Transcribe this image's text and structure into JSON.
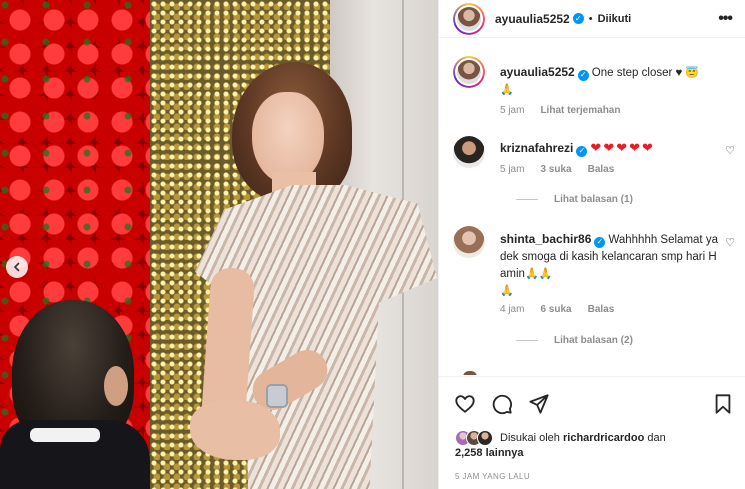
{
  "post": {
    "username": "ayuaulia5252",
    "follow_status": "Diikuti",
    "more_icon": "more-horizontal-icon",
    "caption": {
      "username": "ayuaulia5252",
      "text": "One step closer ♥",
      "emoji": "😇",
      "emoji2": "🙏",
      "time": "5 jam",
      "translate": "Lihat terjemahan"
    },
    "comments": [
      {
        "username": "kriznafahrezi",
        "text": "❤❤❤❤❤",
        "time": "5 jam",
        "likes": "3 suka",
        "reply": "Balas",
        "view_replies": "Lihat balasan (1)"
      },
      {
        "username": "shinta_bachir86",
        "text": "Wahhhhh Selamat ya dek smoga di kasih kelancaran smp hari H amin",
        "emoji": "🙏🙏",
        "emoji2": "🙏",
        "time": "4 jam",
        "likes": "6 suka",
        "reply": "Balas",
        "view_replies": "Lihat balasan (2)"
      }
    ],
    "likes": {
      "prefix": "Disukai oleh",
      "user": "richardricardoo",
      "conj": "dan",
      "count": "2,258 lainnya"
    },
    "posted": "5 JAM YANG LALU",
    "colors": {
      "verified": "#0095f6",
      "heart": "#ed1c24",
      "muted": "#8e8e8e",
      "text": "#262626"
    }
  }
}
